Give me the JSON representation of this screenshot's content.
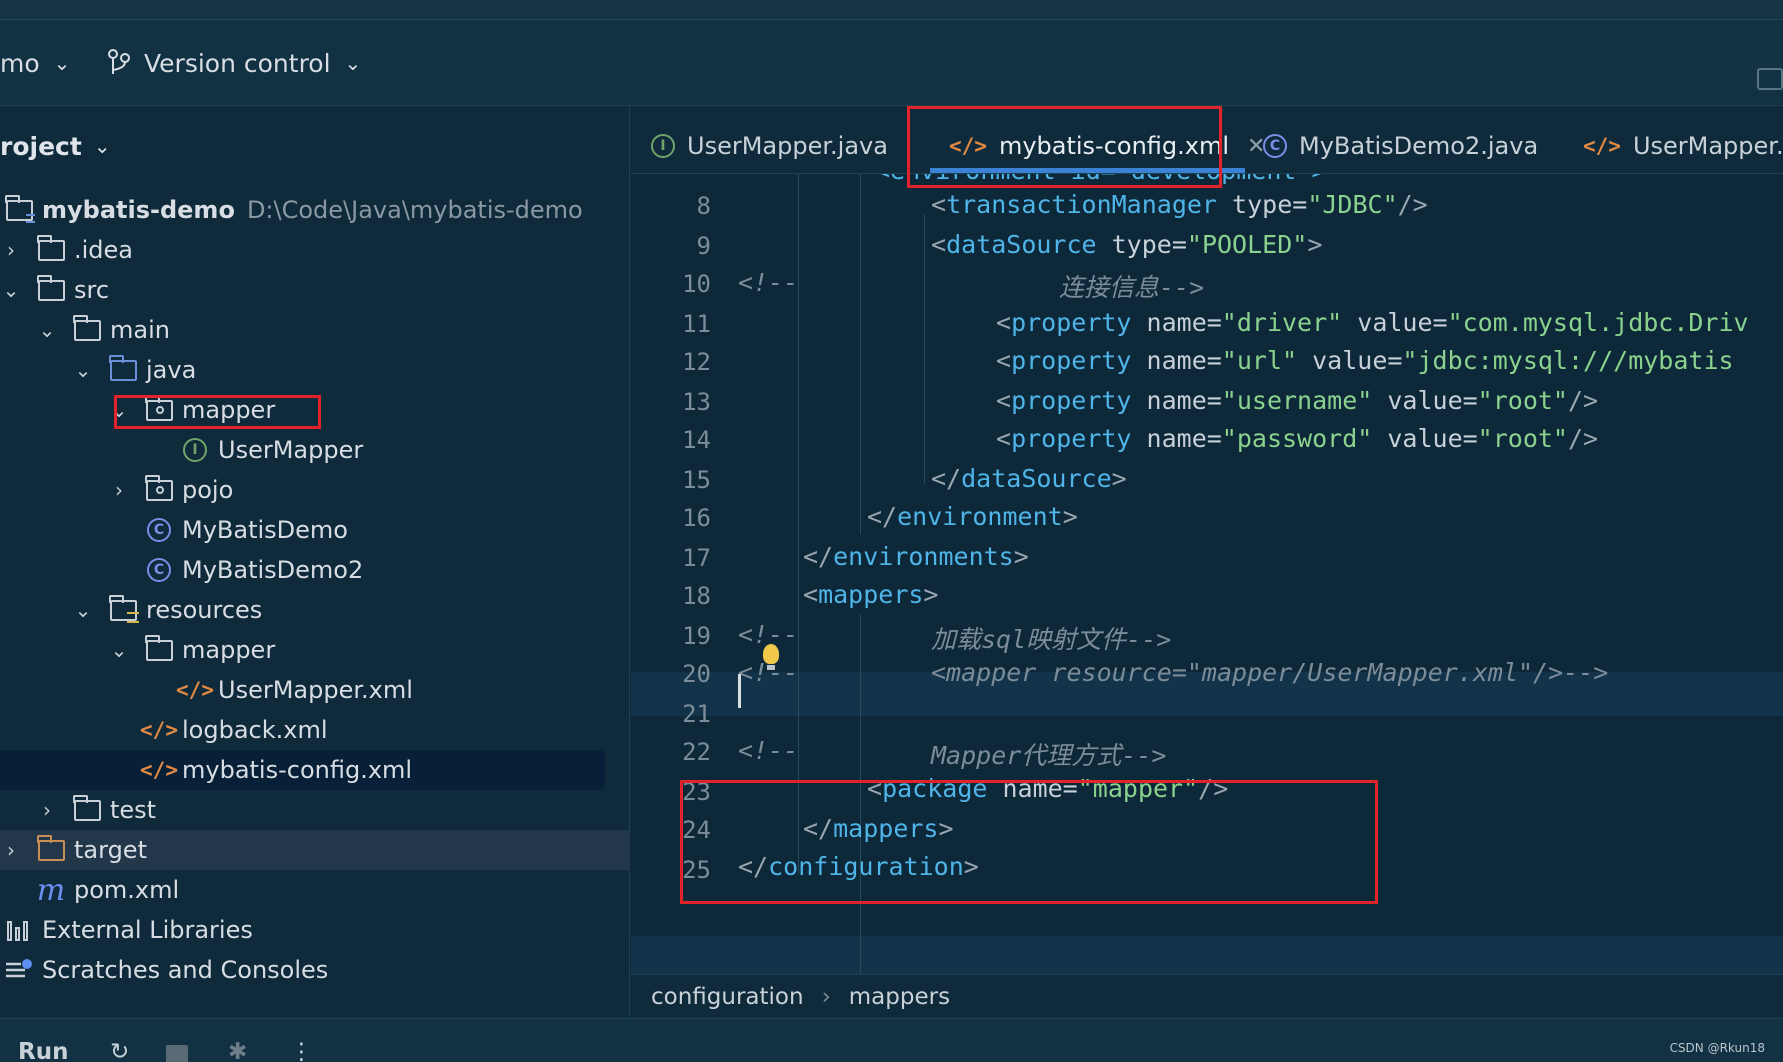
{
  "toolbar": {
    "project_name": "mo",
    "vcs_label": "Version control"
  },
  "project_panel": {
    "title": "roject",
    "root_name": "mybatis-demo",
    "root_path": "D:\\Code\\Java\\mybatis-demo",
    "items": [
      {
        "label": ".idea"
      },
      {
        "label": "src"
      },
      {
        "label": "main"
      },
      {
        "label": "java"
      },
      {
        "label": "mapper"
      },
      {
        "label": "UserMapper"
      },
      {
        "label": "pojo"
      },
      {
        "label": "MyBatisDemo"
      },
      {
        "label": "MyBatisDemo2"
      },
      {
        "label": "resources"
      },
      {
        "label": "mapper"
      },
      {
        "label": "UserMapper.xml"
      },
      {
        "label": "logback.xml"
      },
      {
        "label": "mybatis-config.xml"
      },
      {
        "label": "test"
      },
      {
        "label": "target"
      },
      {
        "label": "pom.xml"
      },
      {
        "label": "External Libraries"
      },
      {
        "label": "Scratches and Consoles"
      }
    ]
  },
  "tabs": [
    {
      "label": "UserMapper.java",
      "icon": "interface-icon"
    },
    {
      "label": "mybatis-config.xml",
      "icon": "xml-icon",
      "active": true
    },
    {
      "label": "MyBatisDemo2.java",
      "icon": "class-icon"
    },
    {
      "label": "UserMapper.xn",
      "icon": "xml-icon"
    }
  ],
  "editor": {
    "line_numbers": [
      "8",
      "9",
      "10",
      "11",
      "12",
      "13",
      "14",
      "15",
      "16",
      "17",
      "18",
      "19",
      "20",
      "21",
      "22",
      "23",
      "24",
      "25"
    ],
    "code": {
      "l8_tag": "transactionManager",
      "l8_attr": " type=",
      "l8_val": "\"JDBC\"",
      "l9_tag": "dataSource",
      "l9_attr": " type=",
      "l9_val": "\"POOLED\"",
      "l10_open": "<!--",
      "l10_text": "连接信息-->",
      "prop_tag": "property",
      "l11_name": "\"driver\"",
      "l11_value": "\"com.mysql.jdbc.Driv",
      "l12_name": "\"url\"",
      "l12_value": "\"jdbc:mysql:///mybatis",
      "l13_name": "\"username\"",
      "l13_value": "\"root\"",
      "l14_name": "\"password\"",
      "l14_value": "\"root\"",
      "name_attr": " name=",
      "value_attr": " value=",
      "l15_tag": "dataSource",
      "l16_tag": "environment",
      "l17_tag": "environments",
      "l18_tag": "mappers",
      "l19_open": "<!--",
      "l19_text": "加载sql映射文件-->",
      "l20_open": "<!--",
      "l20_text": "<mapper resource=\"mapper/UserMapper.xml\"/>-->",
      "l22_open": "<!--",
      "l22_text": "Mapper代理方式-->",
      "l23_tag": "package",
      "l23_attr": " name=",
      "l23_val": "\"mapper\"",
      "l24_tag": "mappers",
      "l25_tag": "configuration"
    }
  },
  "breadcrumb": [
    "configuration",
    "mappers"
  ],
  "bottom_bar": {
    "run_label": "Run",
    "watermark": "CSDN @Rkun18"
  }
}
